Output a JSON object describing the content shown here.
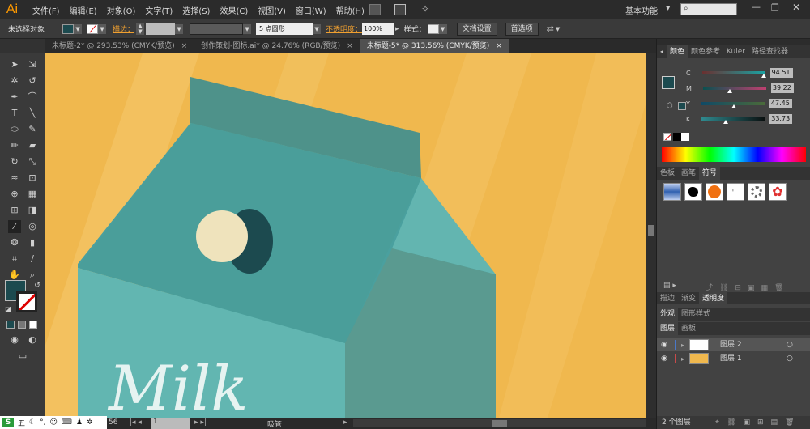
{
  "app": {
    "logo": "Ai",
    "workspace": "基本功能",
    "search_placeholder": ""
  },
  "menu": [
    "文件(F)",
    "编辑(E)",
    "对象(O)",
    "文字(T)",
    "选择(S)",
    "效果(C)",
    "视图(V)",
    "窗口(W)",
    "帮助(H)"
  ],
  "control": {
    "selection_label": "未选择对象",
    "stroke_label": "描边：",
    "brush_label": "5 点圆形",
    "opacity_label": "不透明度：",
    "opacity_value": "100%",
    "style_label": "样式：",
    "doc_setup": "文档设置",
    "preferences": "首选项"
  },
  "tabs": [
    {
      "label": "未标题-2* @ 293.53% (CMYK/预览)",
      "close": "×"
    },
    {
      "label": "创作策划-图标.ai* @ 24.76% (RGB/预览)",
      "close": "×"
    },
    {
      "label": "未标题-5* @ 313.56% (CMYK/预览)",
      "close": "×"
    }
  ],
  "canvas": {
    "milk_text": "Milk"
  },
  "color_panel": {
    "tabs": [
      "颜色",
      "颜色参考",
      "Kuler",
      "路径查找器"
    ],
    "channels": [
      {
        "name": "C",
        "value": "94.51",
        "pct": 0.94
      },
      {
        "name": "M",
        "value": "39.22",
        "pct": 0.39
      },
      {
        "name": "Y",
        "value": "47.45",
        "pct": 0.47
      },
      {
        "name": "K",
        "value": "33.73",
        "pct": 0.34
      }
    ],
    "fill_color": "#1c4a4f"
  },
  "symbols_panel": {
    "tabs": [
      "色板",
      "画笔",
      "符号"
    ]
  },
  "transparency_panel": {
    "tabs": [
      "描边",
      "渐变",
      "透明度"
    ]
  },
  "appearance_panel": {
    "tabs": [
      "外观",
      "图形样式"
    ]
  },
  "layers_panel": {
    "tabs": [
      "图层",
      "画板"
    ],
    "layers": [
      {
        "name": "图层 2",
        "color": "#4a78c8"
      },
      {
        "name": "图层 1",
        "color": "#c84a4a"
      }
    ],
    "count": "2 个图层"
  },
  "status": {
    "zoom": "56",
    "page": "1",
    "info": "吸管"
  },
  "taskbar": {
    "ime": "五"
  }
}
